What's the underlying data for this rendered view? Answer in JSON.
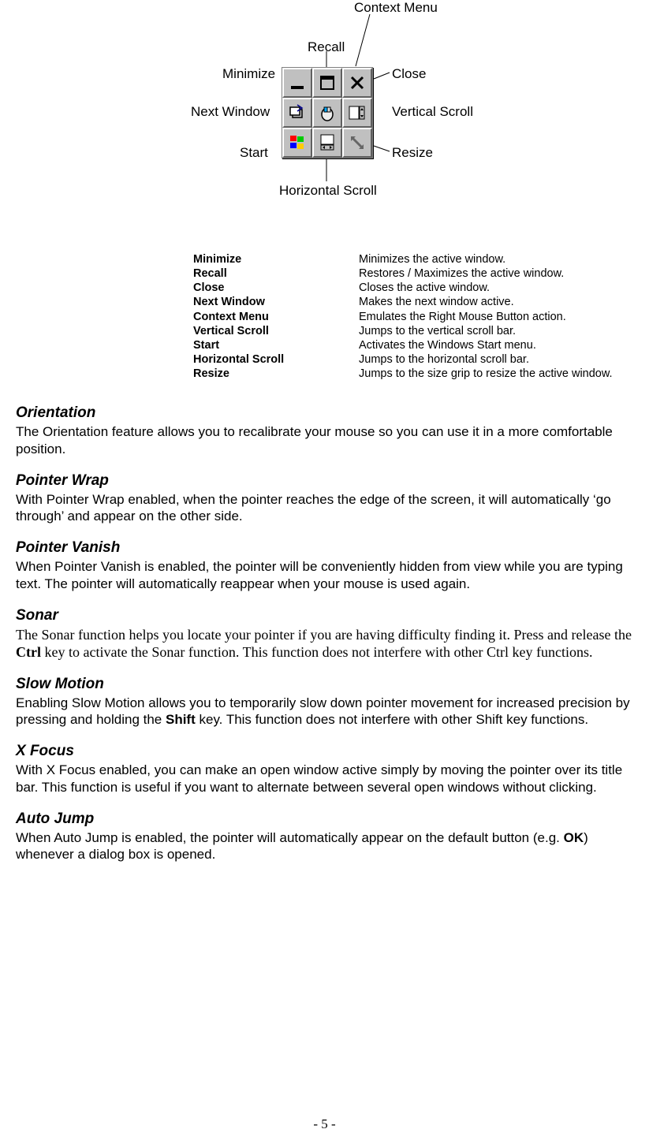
{
  "figure": {
    "labels": {
      "context_menu": "Context Menu",
      "recall": "Recall",
      "minimize": "Minimize",
      "close": "Close",
      "next_window": "Next Window",
      "vertical_scroll": "Vertical Scroll",
      "start": "Start",
      "resize": "Resize",
      "horizontal_scroll": "Horizontal Scroll"
    }
  },
  "definitions": [
    {
      "term": "Minimize",
      "desc": "Minimizes the active window."
    },
    {
      "term": "Recall",
      "desc": "Restores / Maximizes the active window."
    },
    {
      "term": "Close",
      "desc": "Closes the active window."
    },
    {
      "term": "Next Window",
      "desc": "Makes the next window active."
    },
    {
      "term": "Context Menu",
      "desc": "Emulates the Right Mouse Button action."
    },
    {
      "term": "Vertical Scroll",
      "desc": "Jumps to the vertical scroll bar."
    },
    {
      "term": "Start",
      "desc": "Activates the Windows Start menu."
    },
    {
      "term": "Horizontal Scroll",
      "desc": "Jumps to the horizontal scroll bar."
    },
    {
      "term": "Resize",
      "desc": "Jumps to the size grip to resize the active window."
    }
  ],
  "sections": {
    "orientation": {
      "heading": "Orientation",
      "body": "The Orientation feature allows you to recalibrate your mouse so you can use it in a more comfortable position."
    },
    "pointer_wrap": {
      "heading": "Pointer Wrap",
      "body": "With Pointer Wrap enabled, when the pointer reaches the edge of the screen, it will automatically ‘go through’ and appear on the other side."
    },
    "pointer_vanish": {
      "heading": "Pointer Vanish",
      "body": "When Pointer Vanish is enabled, the pointer will be conveniently hidden from view while you are typing text.  The pointer will automatically reappear when your mouse is used again."
    },
    "sonar": {
      "heading": "Sonar",
      "body_pre": "The Sonar function helps you locate your pointer if you are having difficulty finding it.  Press and release the ",
      "body_bold": "Ctrl",
      "body_post": " key to activate the Sonar function.  This function does not interfere with other Ctrl key functions."
    },
    "slow_motion": {
      "heading": "Slow Motion",
      "body_pre": "Enabling Slow Motion allows you to temporarily slow down pointer movement for increased precision by pressing and holding the ",
      "body_bold": "Shift",
      "body_post": " key.  This function does not interfere with other Shift key functions."
    },
    "x_focus": {
      "heading": "X Focus",
      "body": "With X Focus enabled, you can make an open window active simply by moving the pointer over its title bar.  This function is useful if you want to alternate between several open windows without clicking."
    },
    "auto_jump": {
      "heading": "Auto Jump",
      "body_pre": "When Auto Jump is enabled, the pointer will automatically appear on the default button (e.g. ",
      "body_bold": "OK",
      "body_post": ") whenever a dialog box is opened."
    }
  },
  "page_number": "- 5 -"
}
